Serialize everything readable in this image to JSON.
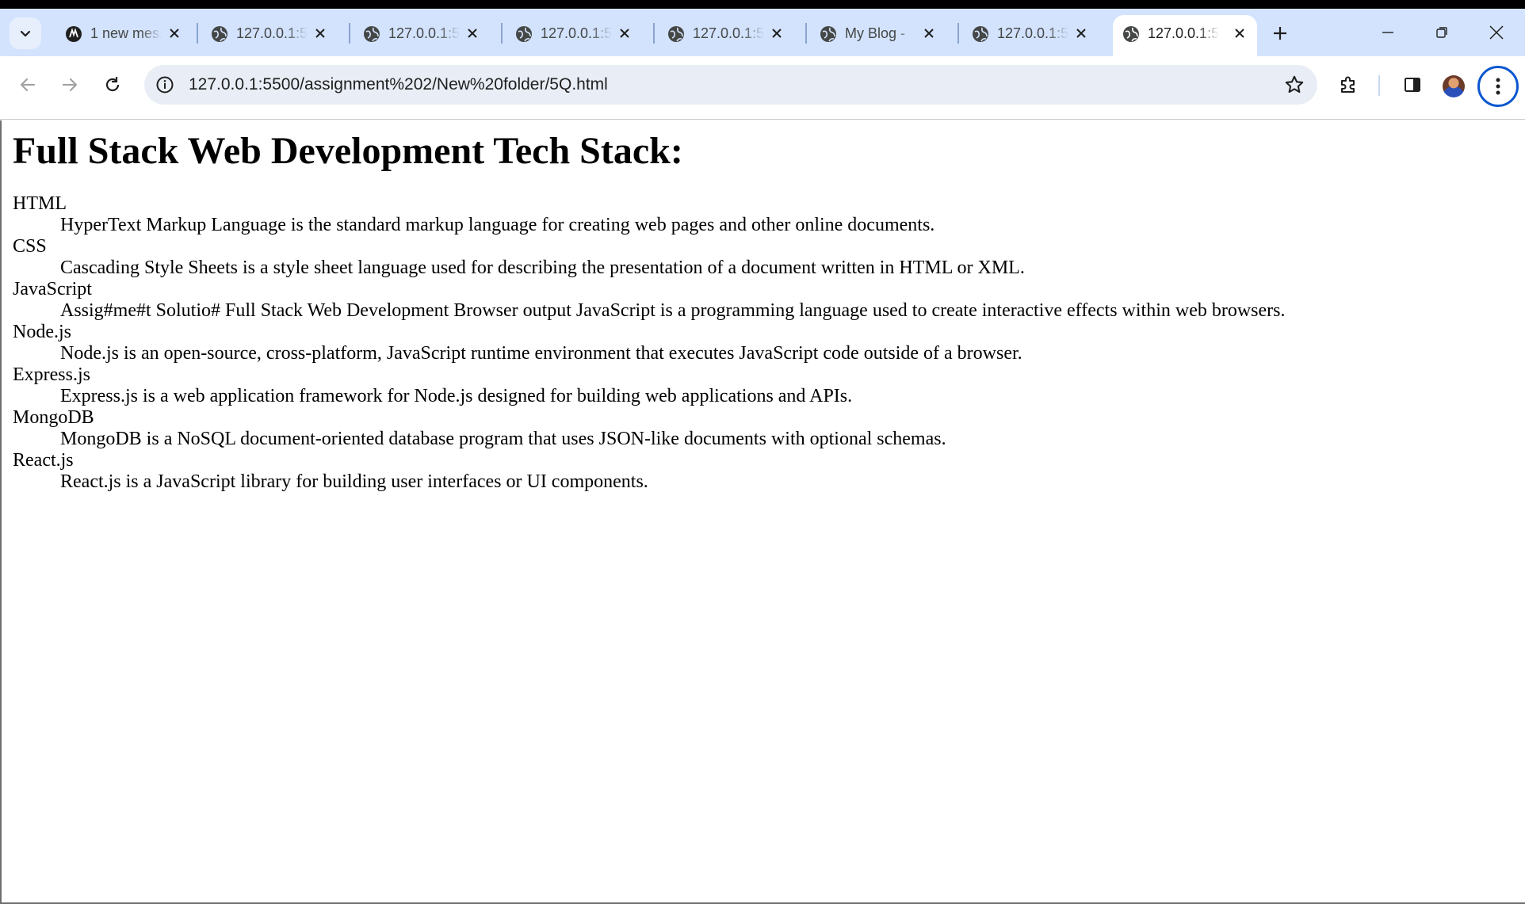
{
  "browser": {
    "tabs": [
      {
        "title": "1 new message",
        "icon": "app-icon",
        "active": false
      },
      {
        "title": "127.0.0.1:5500",
        "icon": "globe-icon",
        "active": false
      },
      {
        "title": "127.0.0.1:5500",
        "icon": "globe-icon",
        "active": false
      },
      {
        "title": "127.0.0.1:5500",
        "icon": "globe-icon",
        "active": false
      },
      {
        "title": "127.0.0.1:5500",
        "icon": "globe-icon",
        "active": false
      },
      {
        "title": "My Blog - ",
        "icon": "globe-icon",
        "active": false
      },
      {
        "title": "127.0.0.1:5500",
        "icon": "globe-icon",
        "active": false
      },
      {
        "title": "127.0.0.1:5500",
        "icon": "globe-icon",
        "active": true
      }
    ],
    "address_bar": {
      "url": "127.0.0.1:5500/assignment%202/New%20folder/5Q.html"
    },
    "accent_color": "#0b57d0",
    "tabstrip_color": "#d3e3fd"
  },
  "page": {
    "heading": "Full Stack Web Development Tech Stack:",
    "definitions": [
      {
        "term": "HTML",
        "description": "HyperText Markup Language is the standard markup language for creating web pages and other online documents."
      },
      {
        "term": "CSS",
        "description": "Cascading Style Sheets is a style sheet language used for describing the presentation of a document written in HTML or XML."
      },
      {
        "term": "JavaScript",
        "description": "Assig#me#t Solutio# Full Stack Web Development Browser output JavaScript is a programming language used to create interactive effects within web browsers."
      },
      {
        "term": "Node.js",
        "description": "Node.js is an open-source, cross-platform, JavaScript runtime environment that executes JavaScript code outside of a browser."
      },
      {
        "term": "Express.js",
        "description": "Express.js is a web application framework for Node.js designed for building web applications and APIs."
      },
      {
        "term": "MongoDB",
        "description": "MongoDB is a NoSQL document-oriented database program that uses JSON-like documents with optional schemas."
      },
      {
        "term": "React.js",
        "description": "React.js is a JavaScript library for building user interfaces or UI components."
      }
    ]
  }
}
